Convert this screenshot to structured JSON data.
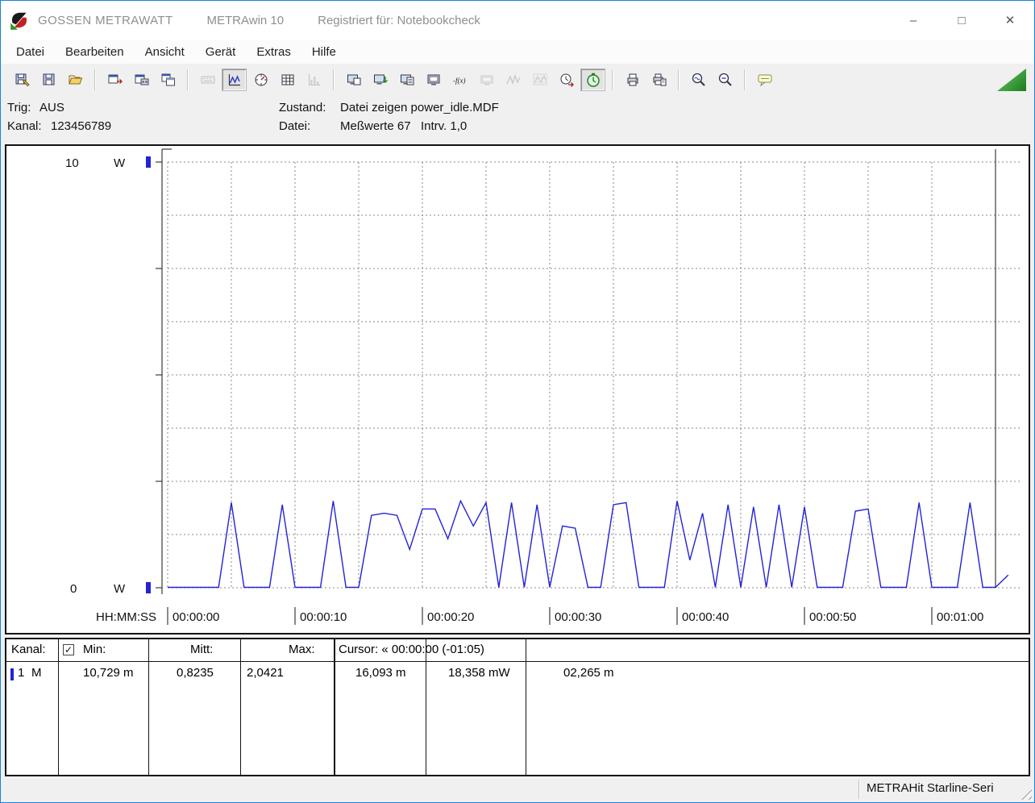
{
  "window": {
    "brand": "GOSSEN METRAWATT",
    "app": "METRAwin 10",
    "registered": "Registriert für: Notebookcheck",
    "minimize": "–",
    "maximize": "□",
    "close": "✕"
  },
  "menu": {
    "items": [
      {
        "key": "datei",
        "label": "Datei"
      },
      {
        "key": "bearbeiten",
        "label": "Bearbeiten"
      },
      {
        "key": "ansicht",
        "label": "Ansicht"
      },
      {
        "key": "geraet",
        "label": "Gerät"
      },
      {
        "key": "extras",
        "label": "Extras"
      },
      {
        "key": "hilfe",
        "label": "Hilfe"
      }
    ]
  },
  "toolbar": {
    "groups": [
      [
        {
          "icon": "save-report"
        },
        {
          "icon": "save"
        },
        {
          "icon": "open-folder"
        }
      ],
      [
        {
          "icon": "window-export"
        },
        {
          "icon": "export-data"
        },
        {
          "icon": "window-forward"
        }
      ],
      [
        {
          "icon": "keyboard",
          "disabled": true
        },
        {
          "icon": "line-chart-view",
          "active": true
        },
        {
          "icon": "analog-meter-view"
        },
        {
          "icon": "table-view"
        },
        {
          "icon": "histogram-view",
          "disabled": true
        }
      ],
      [
        {
          "icon": "device-window"
        },
        {
          "icon": "device-download"
        },
        {
          "icon": "device-list"
        },
        {
          "icon": "device-monitor"
        },
        {
          "icon": "formula"
        },
        {
          "icon": "device-display",
          "disabled": true
        },
        {
          "icon": "waveform",
          "disabled": true
        },
        {
          "icon": "waveform-grid",
          "disabled": true
        },
        {
          "icon": "clock-export"
        },
        {
          "icon": "stopwatch",
          "active": true
        }
      ],
      [
        {
          "icon": "print"
        },
        {
          "icon": "print-copy"
        }
      ],
      [
        {
          "icon": "zoom-in"
        },
        {
          "icon": "zoom-out"
        }
      ],
      [
        {
          "icon": "tooltip"
        }
      ]
    ],
    "status_triangle_color_top": "#6ecc6e",
    "status_triangle_color_bottom": "#1c7a1c"
  },
  "status_panel": {
    "trig_label": "Trig:",
    "trig_value": "AUS",
    "kanal_label": "Kanal:",
    "kanal_value": "123456789",
    "zustand_label": "Zustand:",
    "zustand_value": "Datei zeigen power_idle.MDF",
    "datei_label": "Datei:",
    "datei_value": "Meßwerte 67",
    "intrv_value": "Intrv. 1,0"
  },
  "chart_data": {
    "type": "line",
    "title": "",
    "grid": "dashed",
    "legend_position": "none",
    "y_axis": {
      "unit": "W",
      "min": 0,
      "max": 10,
      "min_label": "0",
      "max_label": "10",
      "divisions": 8
    },
    "x_axis": {
      "label": "HH:MM:SS",
      "ticks": [
        "00:00:00",
        "00:00:10",
        "00:00:20",
        "00:00:30",
        "00:00:40",
        "00:00:50",
        "00:01:00"
      ],
      "tick_interval_s": 10,
      "grid_interval_s": 5,
      "total_s": 67
    },
    "cursor": {
      "time_s": 65,
      "label": "« 00:00:00 (-01:05)"
    },
    "series": [
      {
        "name": "Kanal 1",
        "color": "#2323d6",
        "interval_s": 1.0,
        "values": [
          0.01,
          0.01,
          0.01,
          0.01,
          0.01,
          2.0,
          0.01,
          0.01,
          0.01,
          1.95,
          0.01,
          0.01,
          0.01,
          2.04,
          0.01,
          0.01,
          1.7,
          1.75,
          1.7,
          0.9,
          1.85,
          1.85,
          1.15,
          2.04,
          1.45,
          2.0,
          0.01,
          2.0,
          0.01,
          1.95,
          0.01,
          1.45,
          1.4,
          0.01,
          0.01,
          1.95,
          2.0,
          0.01,
          0.01,
          0.01,
          2.04,
          0.65,
          1.75,
          0.01,
          1.95,
          0.01,
          1.9,
          0.01,
          1.95,
          0.01,
          1.9,
          0.01,
          0.01,
          0.01,
          1.8,
          1.85,
          0.01,
          0.01,
          0.01,
          2.0,
          0.01,
          0.01,
          0.01,
          2.0,
          0.01,
          0.01,
          0.3
        ]
      }
    ]
  },
  "channel_table": {
    "headers": {
      "kanal": "Kanal:",
      "min": "Min:",
      "mitt": "Mitt:",
      "max": "Max:",
      "cursor": "Cursor: « 00:00:00 (-01:05)"
    },
    "checkbox_checked": true,
    "rows": [
      {
        "channel": "1",
        "flag": "M",
        "color": "#2323d6",
        "min": "10,729 m",
        "mitt": "0,8235",
        "max": "2,0421",
        "cursor_a": "16,093 m",
        "cursor_b": "18,358 mW",
        "cursor_c": "02,265 m"
      }
    ]
  },
  "status_bar": {
    "device": "METRAHit Starline-Seri"
  }
}
